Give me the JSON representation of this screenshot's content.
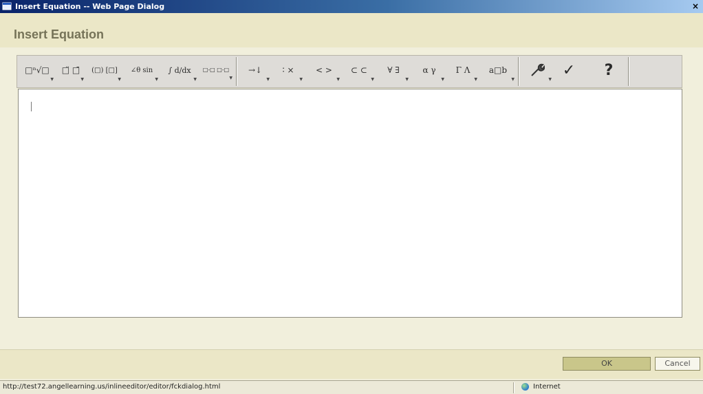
{
  "window": {
    "title": "Insert Equation -- Web Page Dialog",
    "close": "×"
  },
  "dialog": {
    "heading": "Insert Equation"
  },
  "toolbar": {
    "buttons": [
      {
        "label": "□ⁿ√□"
      },
      {
        "label": "□̈ □̄"
      },
      {
        "label": "(□) [□]"
      },
      {
        "label": "∠θ sin"
      },
      {
        "label": "∫ d/dx"
      },
      {
        "label": "□-□ □-□"
      },
      {
        "label": "→↓"
      },
      {
        "label": "∶ ×"
      },
      {
        "label": "< >"
      },
      {
        "label": "⊂ ⊂"
      },
      {
        "label": "∀ ∃"
      },
      {
        "label": "α γ"
      },
      {
        "label": "Γ Λ"
      },
      {
        "label": "a□b"
      },
      {
        "label": "🔧"
      },
      {
        "label": "✓"
      },
      {
        "label": "?"
      }
    ]
  },
  "footer": {
    "ok_label": "OK",
    "cancel_label": "Cancel"
  },
  "statusbar": {
    "url": "http://test72.angellearning.us/inlineeditor/editor/fckdialog.html",
    "zone": "Internet"
  }
}
